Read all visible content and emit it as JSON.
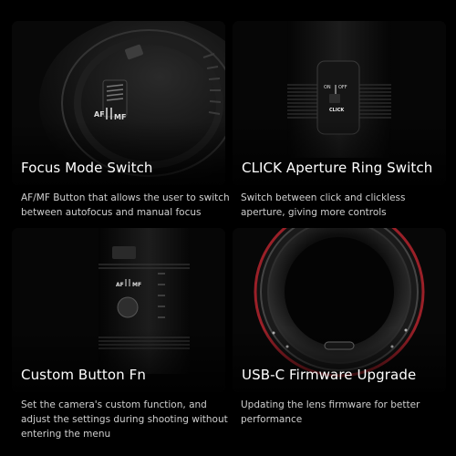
{
  "features": [
    {
      "title": "Focus Mode Switch",
      "description": "AF/MF Button that allows the user to switch between autofocus and manual focus",
      "switch_left": "AF",
      "switch_right": "MF"
    },
    {
      "title": "CLICK Aperture Ring Switch",
      "description": "Switch between click and clickless aperture, giving more controls",
      "switch_on": "ON",
      "switch_off": "OFF",
      "switch_label": "CLICK"
    },
    {
      "title": "Custom Button Fn",
      "description": "Set the camera's custom function, and adjust the settings during shooting without entering the menu",
      "switch_left": "AF",
      "switch_right": "MF"
    },
    {
      "title": "USB-C Firmware Upgrade",
      "description": "Updating the lens firmware for better performance"
    }
  ],
  "colors": {
    "background": "#000000",
    "card": "#0b0b0b",
    "mount_red": "#b3262e"
  }
}
